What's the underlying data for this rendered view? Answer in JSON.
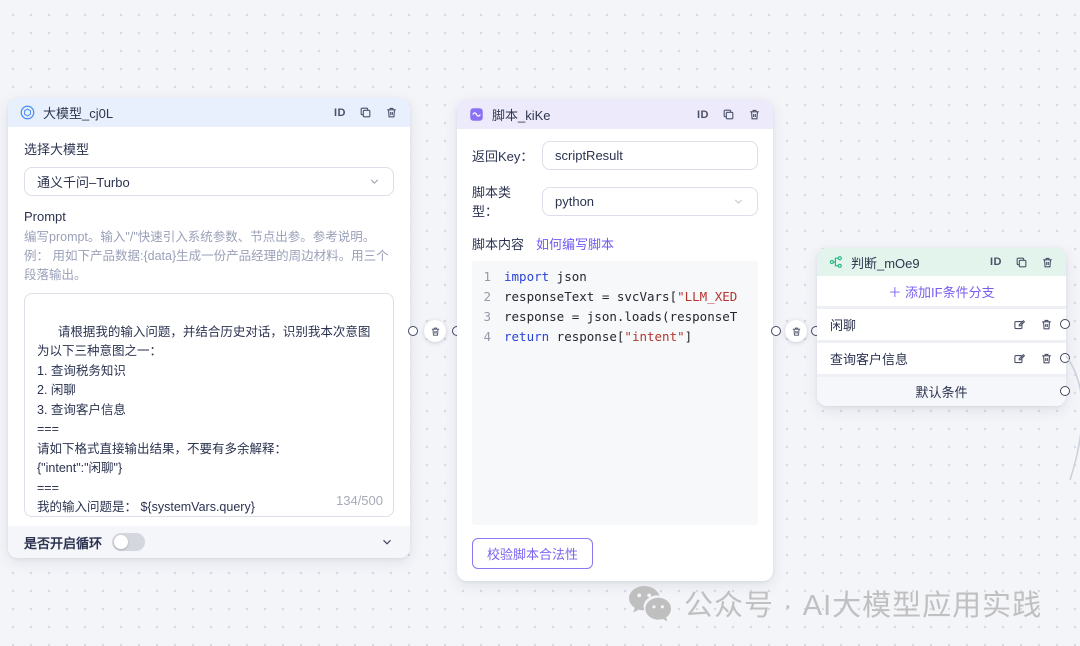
{
  "nodes": {
    "llm": {
      "title": "大模型_cj0L",
      "id_label": "ID",
      "model_label": "选择大模型",
      "model_value": "通义千问–Turbo",
      "prompt_label": "Prompt",
      "prompt_help": "编写prompt。输入\"/\"快速引入系统参数、节点出参。参考说明。\n例： 用如下产品数据:{data}生成一份产品经理的周边材料。用三个段落输出。",
      "prompt_value": "请根据我的输入问题，并结合历史对话，识别我本次意图为以下三种意图之一：\n1. 查询税务知识\n2. 闲聊\n3. 查询客户信息\n===\n请如下格式直接输出结果，不要有多余解释：\n{\"intent\":\"闲聊\"}\n===\n我的输入问题是： ${systemVars.query}",
      "char_count": "134/500",
      "loop_label": "是否开启循环"
    },
    "script": {
      "title": "脚本_kiKe",
      "id_label": "ID",
      "return_key_label": "返回Key：",
      "return_key_value": "scriptResult",
      "type_label": "脚本类型：",
      "type_value": "python",
      "content_label": "脚本内容",
      "help_link": "如何编写脚本",
      "validate_button": "校验脚本合法性",
      "code": {
        "lines": [
          {
            "num": "1",
            "tokens": [
              {
                "text": "import",
                "cls": "kw"
              },
              {
                "text": " json",
                "cls": "pl"
              }
            ]
          },
          {
            "num": "2",
            "tokens": [
              {
                "text": "responseText = svcVars[",
                "cls": "pl"
              },
              {
                "text": "\"LLM_XED",
                "cls": "str"
              }
            ]
          },
          {
            "num": "3",
            "tokens": [
              {
                "text": "response = json.loads(responseT",
                "cls": "pl"
              }
            ]
          },
          {
            "num": "4",
            "tokens": [
              {
                "text": "return",
                "cls": "kw"
              },
              {
                "text": " response[",
                "cls": "pl"
              },
              {
                "text": "\"intent\"",
                "cls": "str"
              },
              {
                "text": "]",
                "cls": "pl"
              }
            ]
          }
        ]
      }
    },
    "judge": {
      "title": "判断_mOe9",
      "id_label": "ID",
      "add_branch_label": "＋ 添加IF条件分支",
      "branches": [
        {
          "label": "闲聊"
        },
        {
          "label": "查询客户信息"
        }
      ],
      "default_label": "默认条件"
    }
  },
  "watermark": {
    "text": "公众号 · AI大模型应用实践"
  },
  "colors": {
    "llm_header": "#e7f0fc",
    "script_header": "#edeafb",
    "judge_header": "#e2f4eb",
    "accent_purple": "#6f5bf2",
    "keyword_blue": "#2b43d6",
    "string_red": "#b4352f"
  }
}
